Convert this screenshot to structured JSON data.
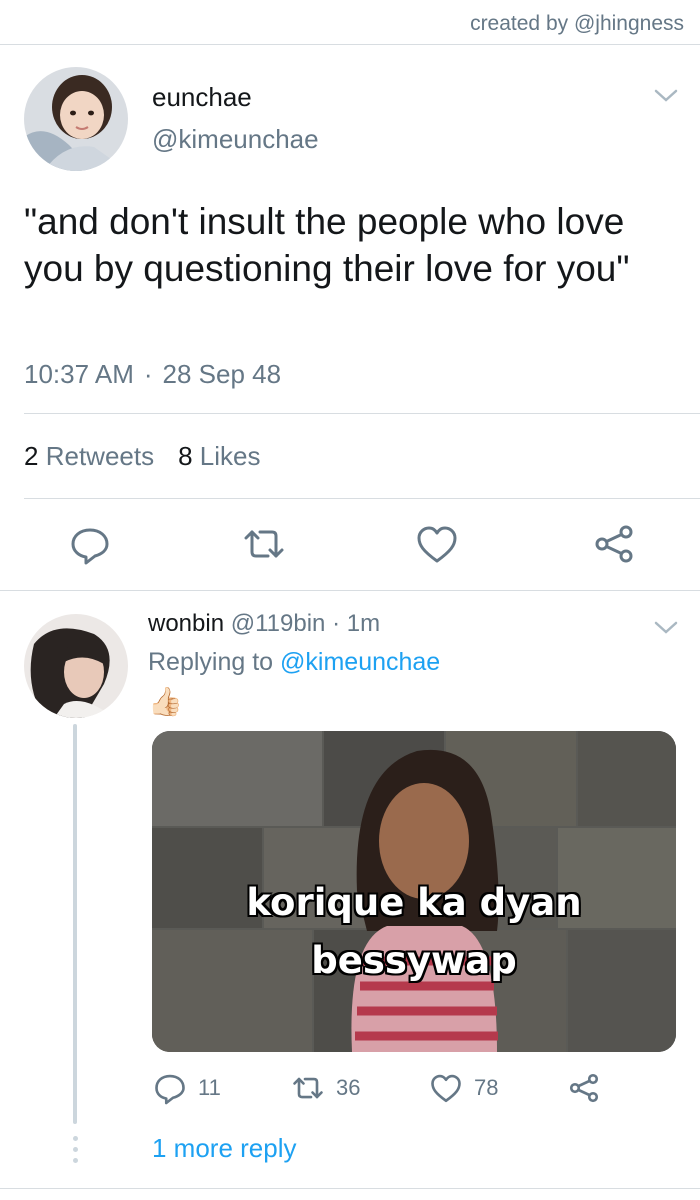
{
  "credit": "created by @jhingness",
  "main_tweet": {
    "display_name": "eunchae",
    "handle": "@kimeunchae",
    "text": "\"and don't insult the people who love you by questioning their love for you\"",
    "time": "10:37 AM",
    "separator": "·",
    "date": "28 Sep 48",
    "retweets_count": "2",
    "retweets_label": "Retweets",
    "likes_count": "8",
    "likes_label": "Likes",
    "actions": [
      "reply-icon",
      "retweet-icon",
      "like-icon",
      "share-icon"
    ]
  },
  "reply_tweet": {
    "display_name": "wonbin",
    "handle": "@119bin",
    "separator": "·",
    "time_ago": "1m",
    "replying_prefix": "Replying to",
    "replying_mention": "@kimeunchae",
    "emoji": "👍🏻",
    "media_caption_line1": "korique ka dyan",
    "media_caption_line2": "bessywap",
    "reply_count": "11",
    "retweet_count": "36",
    "like_count": "78",
    "more_replies": "1 more reply"
  },
  "colors": {
    "link_blue": "#1da1f2",
    "secondary_text": "#657786",
    "divider": "#d8dde1",
    "thread_line": "#ccd6dd"
  }
}
